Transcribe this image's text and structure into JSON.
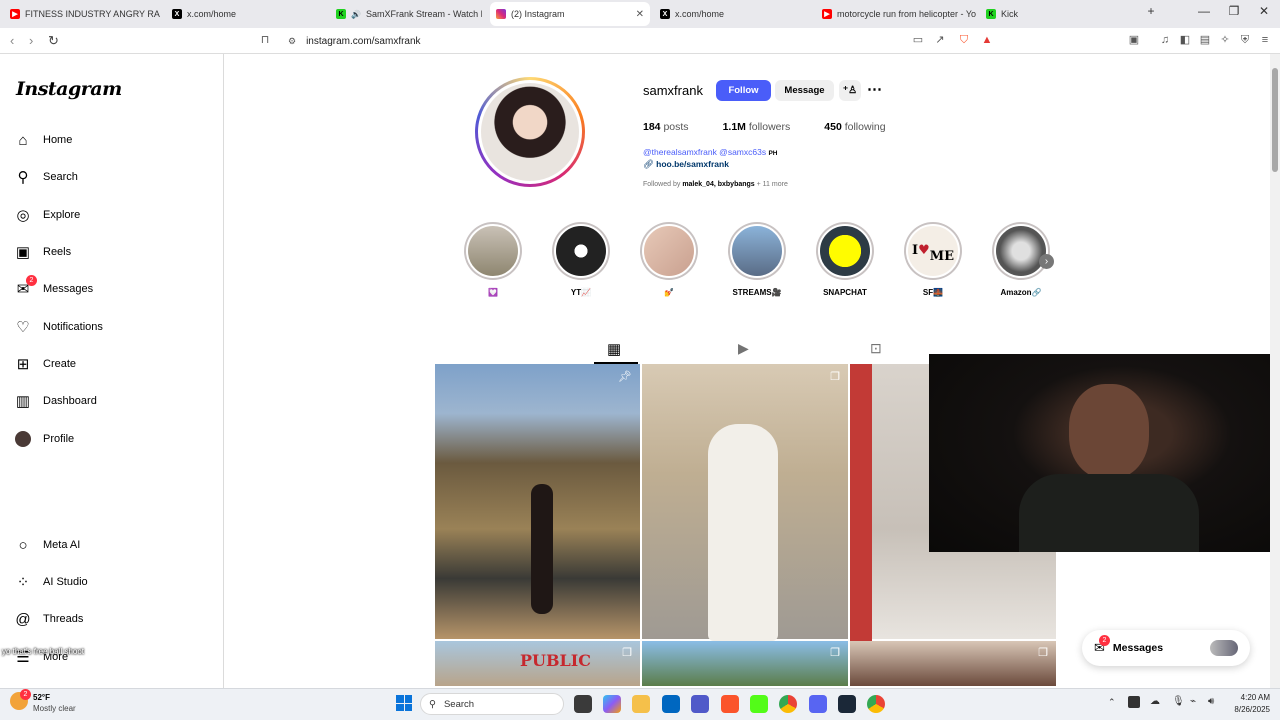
{
  "browser": {
    "tabs": [
      {
        "label": "FITNESS INDUSTRY ANGRY RANT -",
        "favicon": "youtube-icon"
      },
      {
        "label": "x.com/home",
        "favicon": "x-icon"
      },
      {
        "label": "SamXFrank Stream - Watch Live",
        "favicon": "kick-icon"
      },
      {
        "label": "(2) Instagram",
        "favicon": "instagram-icon"
      },
      {
        "label": "x.com/home",
        "favicon": "x-icon"
      },
      {
        "label": "motorcycle run from helicopter - You",
        "favicon": "youtube-icon"
      },
      {
        "label": "Kick",
        "favicon": "kick-icon"
      }
    ],
    "new_tab": "+",
    "url": "instagram.com/samxfrank"
  },
  "sidebar": {
    "logo": "Instagram",
    "items": [
      {
        "label": "Home",
        "icon": "home-icon"
      },
      {
        "label": "Search",
        "icon": "search-icon"
      },
      {
        "label": "Explore",
        "icon": "compass-icon"
      },
      {
        "label": "Reels",
        "icon": "reels-icon"
      },
      {
        "label": "Messages",
        "icon": "messenger-icon",
        "badge": "2"
      },
      {
        "label": "Notifications",
        "icon": "heart-icon"
      },
      {
        "label": "Create",
        "icon": "plus-square-icon"
      },
      {
        "label": "Dashboard",
        "icon": "dashboard-icon"
      },
      {
        "label": "Profile",
        "icon": "avatar-icon"
      }
    ],
    "bottom_items": [
      {
        "label": "Meta AI",
        "icon": "meta-ai-icon"
      },
      {
        "label": "AI Studio",
        "icon": "ai-studio-icon"
      },
      {
        "label": "Threads",
        "icon": "threads-icon"
      },
      {
        "label": "More",
        "icon": "menu-icon"
      }
    ]
  },
  "profile": {
    "username": "samxfrank",
    "follow_label": "Follow",
    "message_label": "Message",
    "stats": {
      "posts_count": "184",
      "posts_label": "posts",
      "followers_count": "1.1M",
      "followers_label": "followers",
      "following_count": "450",
      "following_label": "following"
    },
    "bio_line": "@therealsamxfrank @samxc63s",
    "bio_suffix": "PH",
    "link": "hoo.be/samxfrank",
    "followed_by_prefix": "Followed by",
    "followed_by_names": "malek_04, bxbybangs",
    "followed_by_suffix": "+ 11 more"
  },
  "highlights": [
    {
      "label": "💟"
    },
    {
      "label": "YT📈"
    },
    {
      "label": "💅"
    },
    {
      "label": "STREAMS🎥"
    },
    {
      "label": "SNAPCHAT"
    },
    {
      "label": "SF🌉"
    },
    {
      "label": "Amazon🔗"
    }
  ],
  "profile_tabs": [
    "posts-grid-icon",
    "reels-icon",
    "tagged-icon"
  ],
  "messages_pill": {
    "label": "Messages",
    "badge": "2"
  },
  "chat_overlay": "yo that's free ball shoot",
  "taskbar": {
    "weather_temp": "52°F",
    "weather_desc": "Mostly clear",
    "search_label": "Search",
    "time": "4:20 AM",
    "date": "8/26/2025",
    "weather_badge": "2"
  },
  "colors": {
    "follow_blue": "#4a5df9",
    "link_blue": "#00376b",
    "badge_red": "#ff3040"
  }
}
